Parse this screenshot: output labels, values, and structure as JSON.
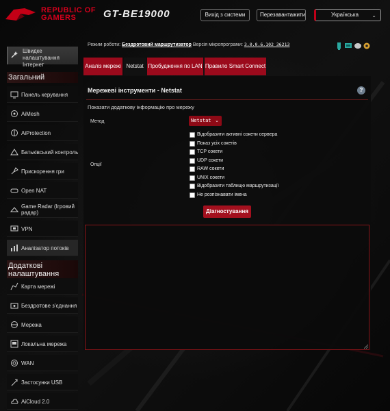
{
  "header": {
    "brand_line1": "REPUBLIC OF",
    "brand_line2": "GAMERS",
    "model": "GT-BE19000",
    "logout": "Вихід з системи",
    "reboot": "Перезавантажити",
    "language": "Українська"
  },
  "sidebar": {
    "quick_setup": "Швидке налаштування Інтернет",
    "general_title": "Загальний",
    "general_items": [
      {
        "label": "Панель керування",
        "icon": "dashboard-icon"
      },
      {
        "label": "AiMesh",
        "icon": "mesh-icon"
      },
      {
        "label": "AiProtection",
        "icon": "shield-icon"
      },
      {
        "label": "Батьківський контроль",
        "icon": "parental-icon"
      },
      {
        "label": "Прискорення гри",
        "icon": "rocket-icon"
      },
      {
        "label": "Open NAT",
        "icon": "gamepad-icon"
      },
      {
        "label": "Game Radar (Ігровий радар)",
        "icon": "radar-icon"
      },
      {
        "label": "VPN",
        "icon": "vpn-icon"
      },
      {
        "label": "Аналізатор потоків",
        "icon": "traffic-analyzer-icon"
      }
    ],
    "advanced_title": "Додаткові налаштування",
    "advanced_items": [
      {
        "label": "Карта мережі",
        "icon": "network-map-icon"
      },
      {
        "label": "Бездротове з'єднання",
        "icon": "wireless-icon"
      },
      {
        "label": "Мережа",
        "icon": "globe-icon"
      },
      {
        "label": "Локальна мережа",
        "icon": "lan-icon"
      },
      {
        "label": "WAN",
        "icon": "wan-icon"
      },
      {
        "label": "Застосунки USB",
        "icon": "usb-icon"
      },
      {
        "label": "AiCloud 2.0",
        "icon": "cloud-icon"
      }
    ]
  },
  "status": {
    "mode_label": "Режим роботи:",
    "mode_value": "Бездротовий маршрутизатор",
    "fw_label": "Версія мікропрограми:",
    "fw_value": "3.0.0.6.102_36213"
  },
  "tabs": [
    "Аналіз мережі",
    "Netstat",
    "Пробудження по LAN",
    "Правило Smart Connect"
  ],
  "panel": {
    "title": "Мережеві інструменти - Netstat",
    "help": "?",
    "description": "Показати додаткову інформацію про мережу",
    "method_label": "Метод",
    "method_value": "Netstat",
    "options_label": "Опції",
    "options": [
      "Відобразити активні сокети сервера",
      "Показ усіх сокетів",
      "TCP сокети",
      "UDP сокети",
      "RAW сокети",
      "UNIX сокети",
      "Відобразити таблицю маршрутизації",
      "Не розпізнавати імена"
    ],
    "diagnose_button": "Діагностування",
    "output": ""
  },
  "colors": {
    "accent_red": "#a3101e",
    "brand_red": "#d4001c",
    "background": "#050505"
  }
}
